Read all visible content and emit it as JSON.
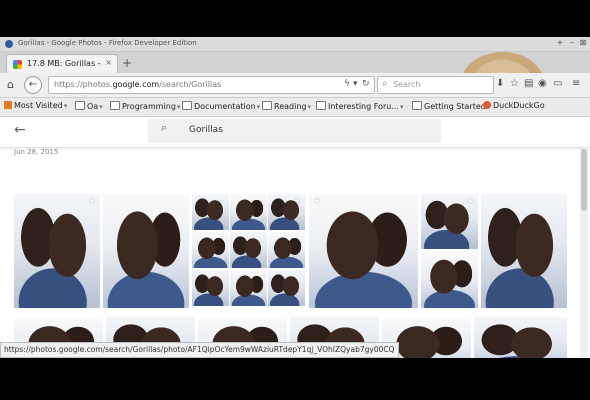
{
  "window": {
    "title": "Gorillas - Google Photos - Firefox Developer Edition",
    "controls": [
      "+",
      "–",
      "⊠"
    ]
  },
  "tab": {
    "label": "17.8 MB: Gorillas - G...",
    "close": "×"
  },
  "newtab": "+",
  "nav": {
    "url_prefix": "https://photos.",
    "url_domain": "google.com",
    "url_suffix": "/search/Gorillas",
    "search_placeholder": "Search"
  },
  "bookmarks": {
    "most_visited": "Most Visited",
    "oa": "Oa",
    "programming": "Programming",
    "documentation": "Documentation",
    "reading": "Reading",
    "interesting": "Interesting Foru...",
    "getting_started": "Getting Started",
    "duckduckgo": "DuckDuckGo"
  },
  "photos": {
    "search_query": "Gorillas",
    "date_label": "Jun 28, 2015"
  },
  "status": {
    "url": "https://photos.google.com/search/Gorillas/photo/AF1QipOcYem9wWAziuRTdepY1qj_VOhIZQyab7gy00CQ"
  },
  "colors": {
    "accent_blue": "#4285f4",
    "photo_shirt": "#37507f"
  }
}
